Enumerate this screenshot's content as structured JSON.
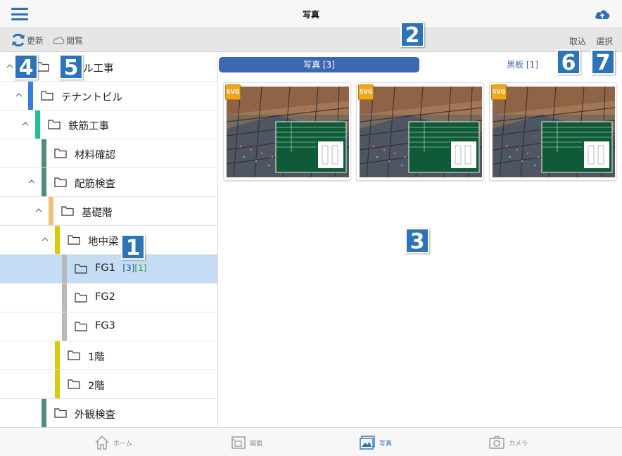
{
  "header": {
    "title": "写真",
    "menu_icon": "hamburger-menu-icon",
    "upload_icon": "cloud-upload-icon"
  },
  "toolbar": {
    "update_label": "更新",
    "view_label": "閲覧",
    "import_label": "取込",
    "select_label": "選択"
  },
  "badges": [
    "1",
    "2",
    "3",
    "4",
    "5",
    "6",
    "7"
  ],
  "tree": {
    "rows": [
      {
        "label": "サンプル工事",
        "visible_fragment": "ル工事",
        "bar_color": ""
      },
      {
        "label": "テナントビル",
        "bar_color": "#3a7be0"
      },
      {
        "label": "鉄筋工事",
        "bar_color": "#1fbf9a"
      },
      {
        "label": "材料確認",
        "bar_color": "#4e8c7c"
      },
      {
        "label": "配筋検査",
        "bar_color": "#4e8c7c"
      },
      {
        "label": "基礎階",
        "bar_color": "#f0c27a"
      },
      {
        "label": "地中梁",
        "bar_color": "#d6c90e"
      },
      {
        "label": "FG1",
        "bar_color": "#b8b8b8",
        "count_photo": "[3]",
        "count_board": "[1]",
        "selected": true
      },
      {
        "label": "FG2",
        "bar_color": "#b8b8b8"
      },
      {
        "label": "FG3",
        "bar_color": "#b8b8b8"
      },
      {
        "label": "1階",
        "bar_color": "#d6c90e"
      },
      {
        "label": "2階",
        "bar_color": "#d6c90e"
      },
      {
        "label": "外観検査",
        "bar_color": "#4e8c7c"
      }
    ]
  },
  "segment": {
    "photo_label": "写真 [3]",
    "board_label": "黒板 [1]"
  },
  "photos": [
    {
      "tag": "SVG"
    },
    {
      "tag": "SVG"
    },
    {
      "tag": "SVG"
    }
  ],
  "tabbar": {
    "tabs": [
      {
        "label": "ホーム",
        "icon": "home-icon"
      },
      {
        "label": "図面",
        "icon": "drawing-icon"
      },
      {
        "label": "写真",
        "icon": "photo-icon",
        "active": true
      },
      {
        "label": "カメラ",
        "icon": "camera-icon"
      }
    ]
  },
  "colors": {
    "accent": "#2f6fb6",
    "segment_active": "#3e67b3",
    "selected_row": "#c4dcf4",
    "badge": "#2c73b8"
  }
}
